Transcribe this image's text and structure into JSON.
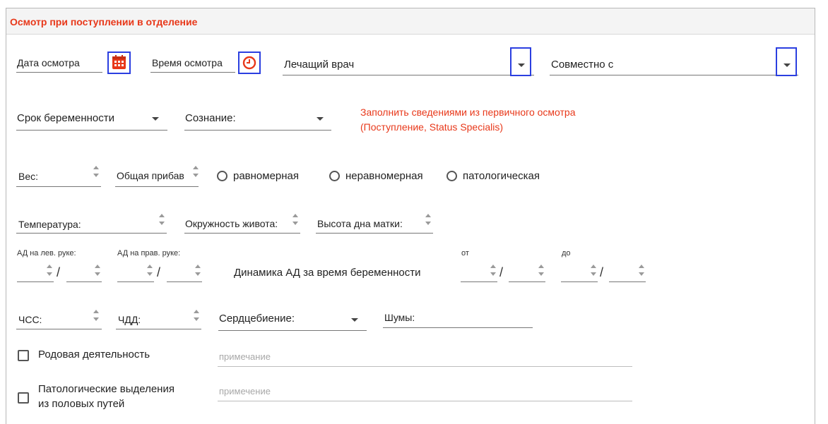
{
  "header": {
    "title": "Осмотр при поступлении в отделение"
  },
  "row1": {
    "exam_date_label": "Дата осмотра",
    "exam_time_label": "Время осмотра",
    "doctor_label": "Лечащий врач",
    "together_label": "Совместно с"
  },
  "row2": {
    "pregnancy_term_label": "Срок беременности",
    "consciousness_label": "Сознание:",
    "note_line1": "Заполнить сведениями из первичного осмотра",
    "note_line2": "(Поступление, Status Specialis)"
  },
  "row3": {
    "weight_label": "Вес:",
    "total_gain_label": "Общая прибав",
    "radio_options": [
      "равномерная",
      "неравномерная",
      "патологическая"
    ]
  },
  "row4": {
    "temperature_label": "Температура:",
    "abdomen_label": "Окружность живота:",
    "fundus_label": "Высота дна матки:"
  },
  "row5": {
    "bp_left_label": "АД на лев. руке:",
    "bp_right_label": "АД на прав. руке:",
    "dynamics_label": "Динамика АД за время беременности",
    "from_label": "от",
    "to_label": "до",
    "slash": "/"
  },
  "row6": {
    "hr_label": "ЧСС:",
    "rr_label": "ЧДД:",
    "heartbeat_label": "Сердцебиение:",
    "noise_label": "Шумы:"
  },
  "row7": {
    "labor_label": "Родовая деятельность",
    "labor_note_placeholder": "примечание"
  },
  "row8": {
    "discharge_label_line1": "Патологические выделения",
    "discharge_label_line2": "из половых путей",
    "discharge_note_placeholder": "примечение"
  },
  "colors": {
    "accent": "#e8381a",
    "highlight_box": "#2b3fe0"
  },
  "icons": {
    "date": "calendar-icon",
    "time": "clock-icon",
    "dropdown": "caret-down-icon",
    "spinner": "spinner-arrows-icon"
  }
}
